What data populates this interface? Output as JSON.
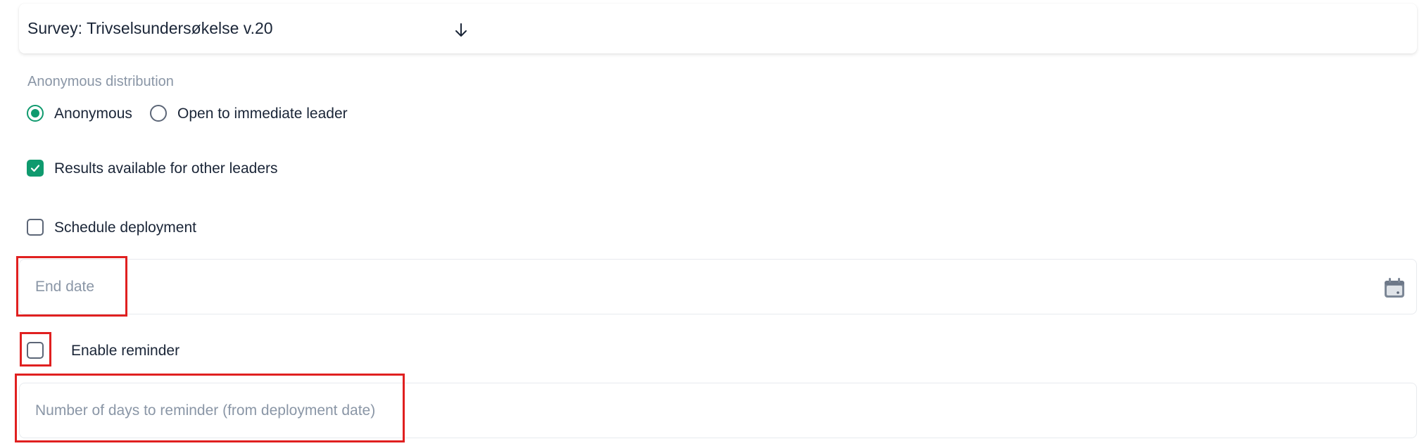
{
  "survey": {
    "label": "Survey: Trivselsundersøkelse v.20",
    "arrow_icon": "arrow-down-icon"
  },
  "distribution": {
    "label": "Anonymous distribution",
    "options": [
      {
        "label": "Anonymous",
        "selected": true
      },
      {
        "label": "Open to immediate leader",
        "selected": false
      }
    ]
  },
  "results_other_leaders": {
    "label": "Results available for other leaders",
    "checked": true
  },
  "schedule_deployment": {
    "label": "Schedule deployment",
    "checked": false
  },
  "end_date": {
    "placeholder": "End date",
    "value": "",
    "icon": "calendar-icon"
  },
  "enable_reminder": {
    "label": "Enable reminder",
    "checked": false
  },
  "reminder_days": {
    "placeholder": "Number of days to reminder (from deployment date)",
    "value": ""
  },
  "colors": {
    "accent": "#0f9a6e",
    "text": "#1a2537",
    "muted": "#8a96a6",
    "highlight": "#e02020"
  }
}
